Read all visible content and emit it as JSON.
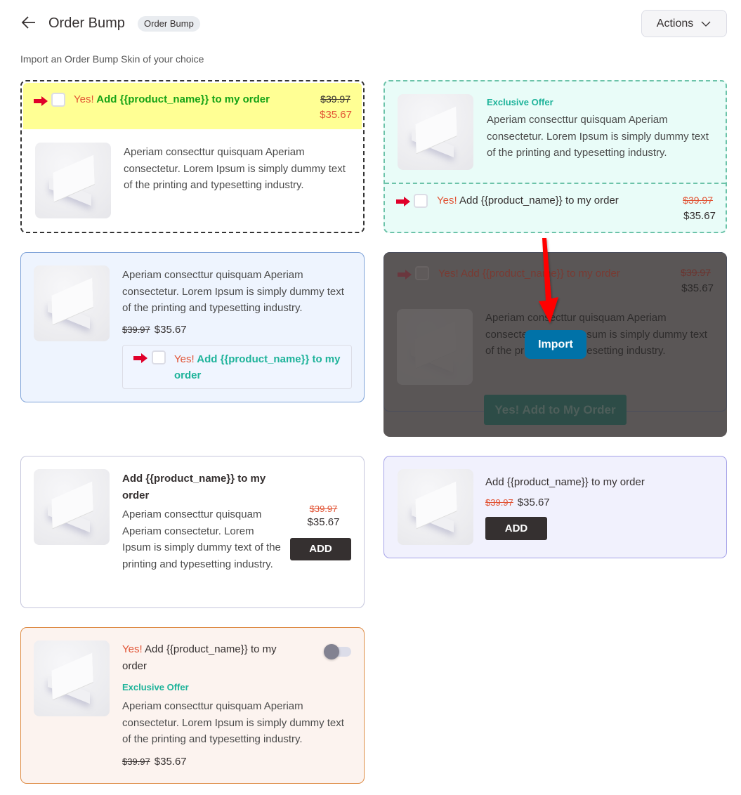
{
  "header": {
    "back_icon": "arrow-left-icon",
    "title": "Order Bump",
    "badge": "Order Bump",
    "actions_label": "Actions",
    "actions_icon": "chevron-down-icon"
  },
  "subtitle": "Import an Order Bump Skin of your choice",
  "common": {
    "yes": "Yes!",
    "add_product": "Add {{product_name}} to my order",
    "description": "Aperiam consecttur quisquam Aperiam consectetur. Lorem Ipsum is simply dummy text of the printing and typesetting industry.",
    "old_price": "$39.97",
    "new_price": "$35.67",
    "exclusive_offer": "Exclusive Offer",
    "add_button": "ADD"
  },
  "skins": [
    {
      "id": "skin-1",
      "offer_label": "Add {{product_name}} to my order",
      "old_price": "$39.97",
      "new_price": "$35.67",
      "description": "Aperiam consecttur quisquam Aperiam consectetur. Lorem Ipsum is simply dummy text of the printing and typesetting industry.",
      "checked": false
    },
    {
      "id": "skin-2",
      "tag": "Exclusive Offer",
      "description": "Aperiam consecttur quisquam Aperiam consectetur. Lorem Ipsum is simply dummy text of the printing and typesetting industry.",
      "offer_label": "Add {{product_name}} to my order",
      "old_price": "$39.97",
      "new_price": "$35.67",
      "checked": false
    },
    {
      "id": "skin-3",
      "description": "Aperiam consecttur quisquam Aperiam consectetur. Lorem Ipsum is simply dummy text of the printing and typesetting industry.",
      "old_price": "$39.97",
      "new_price": "$35.67",
      "offer_label": "Add {{product_name}} to my order",
      "checked": false
    },
    {
      "id": "skin-4",
      "offer_label": "Yes! Add {{product_name}} to my order",
      "old_price": "$39.97",
      "new_price": "$35.67",
      "description": "Aperiam consecttur quisquam Aperiam consectetur. Lorem Ipsum is simply dummy text of the printing and typesetting industry.",
      "cta_label": "Yes! Add to My Order",
      "import_label": "Import",
      "hovered": true
    },
    {
      "id": "skin-5",
      "title": "Add {{product_name}} to my order",
      "description": "Aperiam consecttur quisquam Aperiam consectetur. Lorem Ipsum is simply dummy text of the printing and typesetting industry.",
      "old_price": "$39.97",
      "new_price": "$35.67",
      "button_label": "ADD"
    },
    {
      "id": "skin-6",
      "title": "Add {{product_name}} to my order",
      "old_price": "$39.97",
      "new_price": "$35.67",
      "button_label": "ADD"
    },
    {
      "id": "skin-7",
      "title": "Add {{product_name}} to my order",
      "tag": "Exclusive Offer",
      "description": "Aperiam consecttur quisquam Aperiam consectetur. Lorem Ipsum is simply dummy text of the printing and typesetting industry.",
      "old_price": "$39.97",
      "new_price": "$35.67",
      "toggle_on": false
    }
  ],
  "colors": {
    "accent_red": "#e15334",
    "accent_green": "#16a316",
    "accent_teal": "#1eb39a",
    "import_blue": "#0072a8",
    "dark_button": "#353030",
    "annotation_arrow": "#ff0000"
  }
}
